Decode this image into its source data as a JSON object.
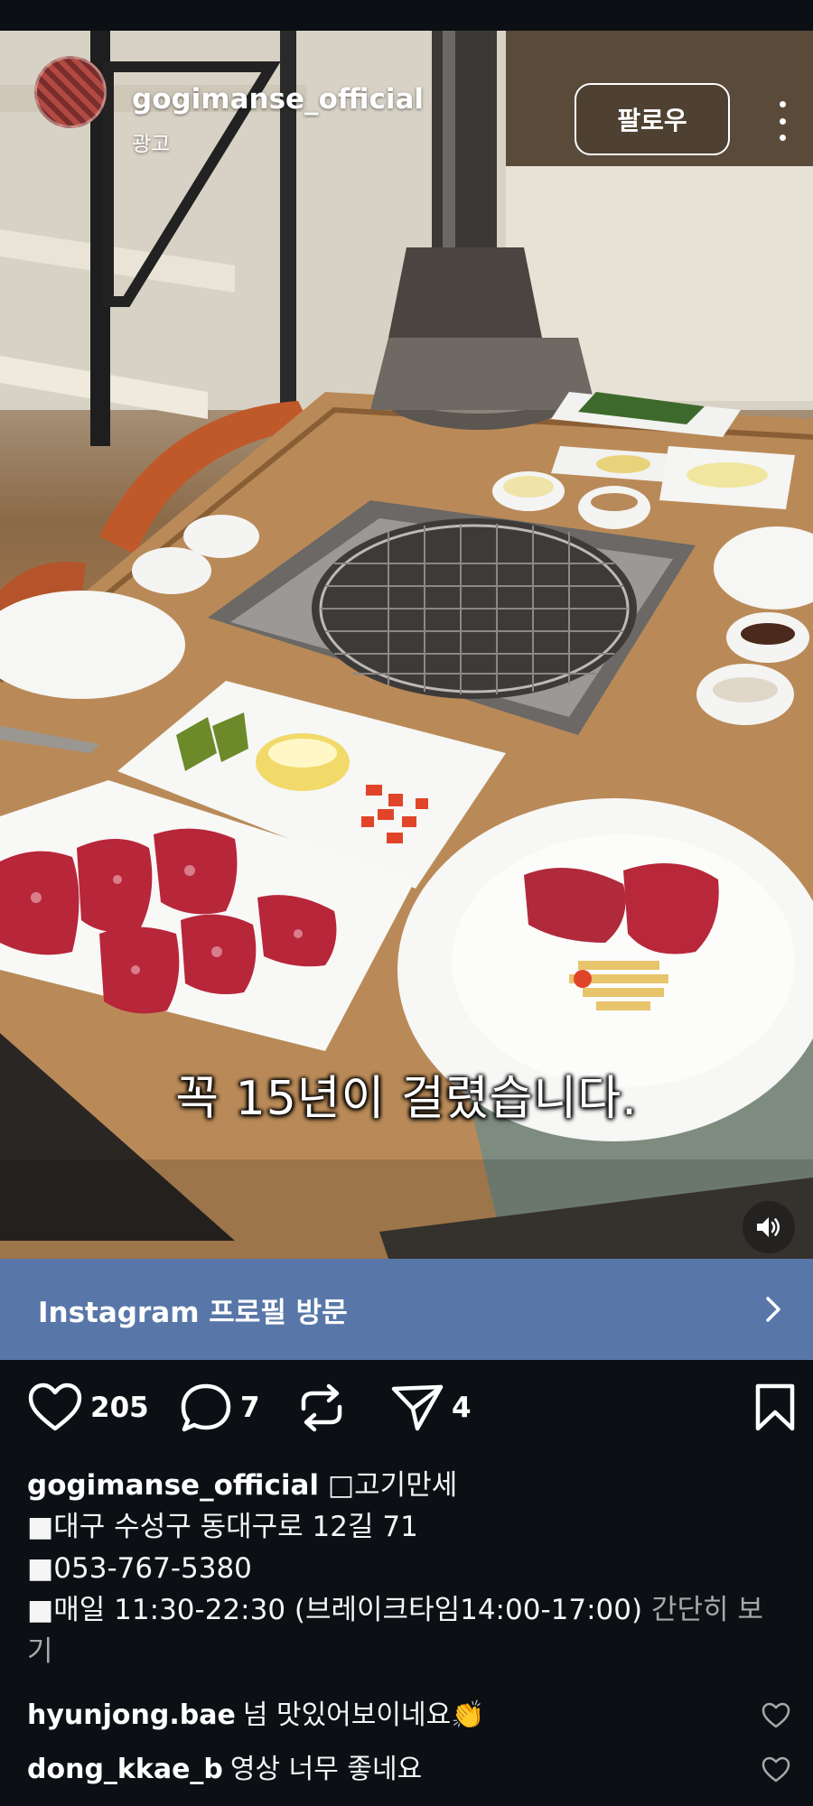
{
  "post": {
    "username": "gogimanse_official",
    "sponsored_label": "광고",
    "follow_label": "팔로우",
    "subtitle": "꼭 15년이 걸렸습니다."
  },
  "cta": {
    "label": "Instagram 프로필 방문"
  },
  "actions": {
    "likes": "205",
    "comments": "7",
    "shares": "4"
  },
  "caption": {
    "username": "gogimanse_official",
    "title": "□고기만세",
    "address": "■대구 수성구 동대구로 12길 71",
    "phone": "■053-767-5380",
    "hours": "■매일 11:30-22:30 (브레이크타임14:00-17:00)",
    "more_label": "간단히 보기"
  },
  "comments": [
    {
      "user": "hyunjong.bae",
      "text": "넘 맛있어보이네요👏"
    },
    {
      "user": "dong_kkae_b",
      "text": "영상 너무 좋네요"
    }
  ],
  "colors": {
    "background": "#0c1014",
    "cta_bar": "#5877a8",
    "secondary_text": "#a8a8a8"
  },
  "icons": {
    "like": "heart-icon",
    "comment": "comment-bubble-icon",
    "repost": "repost-icon",
    "share": "send-icon",
    "save": "bookmark-icon",
    "more": "more-vertical-icon",
    "mute": "volume-icon",
    "cta_arrow": "chevron-right-icon"
  }
}
